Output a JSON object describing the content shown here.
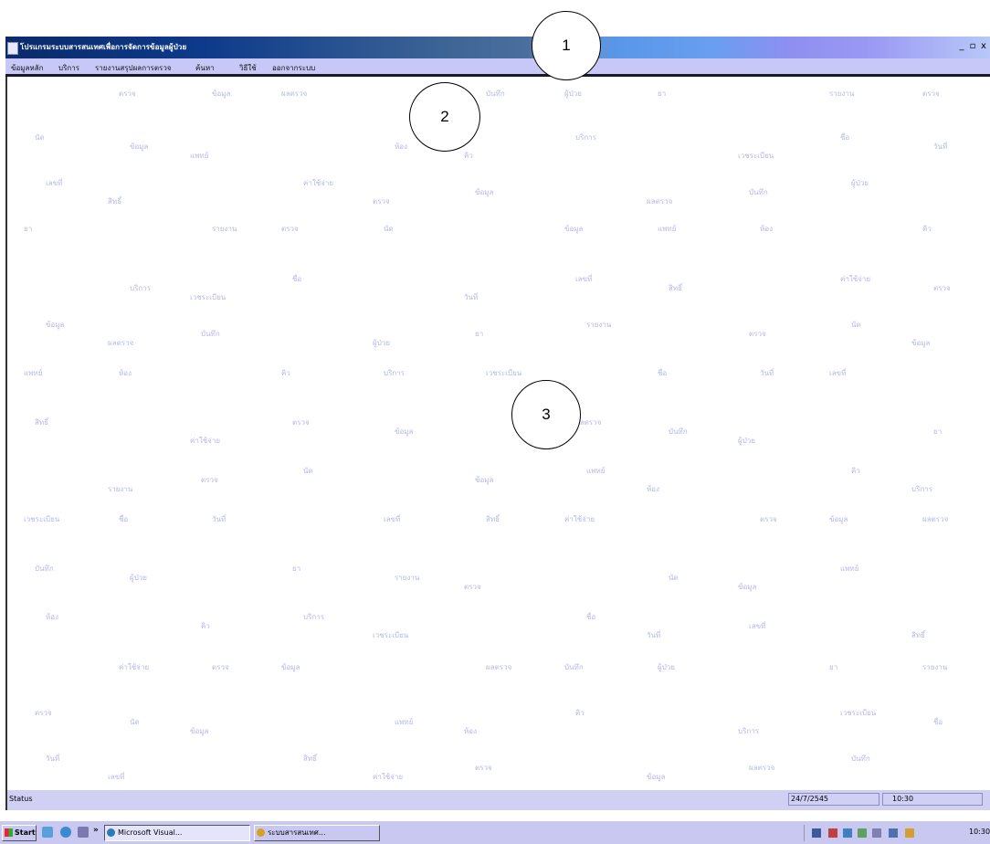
{
  "window": {
    "title": "โปรแกรมระบบสารสนเทศเพื่อการจัดการข้อมูลผู้ป่วย",
    "controls": {
      "minimize": "_",
      "maximize": "▫",
      "close": "x"
    }
  },
  "menu": {
    "items": [
      "ข้อมูลหลัก",
      "บริการ",
      "รายงานสรุปผลการตรวจ",
      "ค้นหา",
      "วิธีใช้",
      "ออกจากระบบ"
    ]
  },
  "canvas": {
    "faint_entries": [
      "ตรวจ",
      "ข้อมูล",
      "ผลตรวจ",
      "บันทึก",
      "ผู้ป่วย",
      "ยา",
      "รายงาน",
      "ตรวจ",
      "นัด",
      "ข้อมูล",
      "แพทย์",
      "ห้อง",
      "คิว",
      "บริการ",
      "เวชระเบียน",
      "ชื่อ",
      "วันที่",
      "เลขที่",
      "สิทธิ์",
      "ค่าใช้จ่าย"
    ]
  },
  "callouts": [
    "1",
    "2",
    "3"
  ],
  "statusbar": {
    "text": "Status",
    "pane1": "24/7/2545",
    "pane2": "10:30"
  },
  "taskbar": {
    "start_label": "Start",
    "quick_more": "»",
    "tasks": [
      "Microsoft Visual...",
      "ระบบสารสนเทศ..."
    ],
    "clock": "10:30"
  },
  "colors": {
    "titlebar_start": "#0a2a6a",
    "menubar": "#c8c8f8",
    "statusbar": "#d0d0f4",
    "taskbar": "#c8c8f0",
    "watermark_text": "#b4b8e8"
  }
}
